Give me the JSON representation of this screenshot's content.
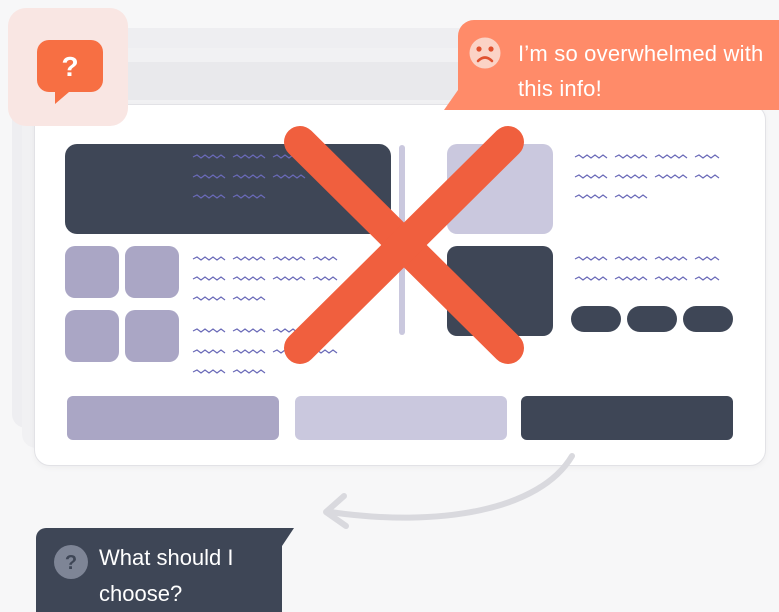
{
  "speech_bubble": {
    "text": "I’m so overwhelmed with this info!",
    "color": "#ff8b69"
  },
  "question_box": {
    "text": "What should I choose?",
    "color": "#3e4656"
  },
  "help_icon": {
    "name": "question-bubble-icon",
    "glyph": "?",
    "color": "#f76f43"
  },
  "question_icon": {
    "name": "question-circle-icon",
    "glyph": "?"
  },
  "sad_icon": {
    "name": "sad-face-icon"
  },
  "cross": {
    "name": "red-cross-mark",
    "color": "#f05f3e"
  },
  "colors": {
    "dark": "#3e4656",
    "purple": "#aaa6c5",
    "lavender": "#cac8de",
    "squiggle": "#6a6ab8"
  }
}
